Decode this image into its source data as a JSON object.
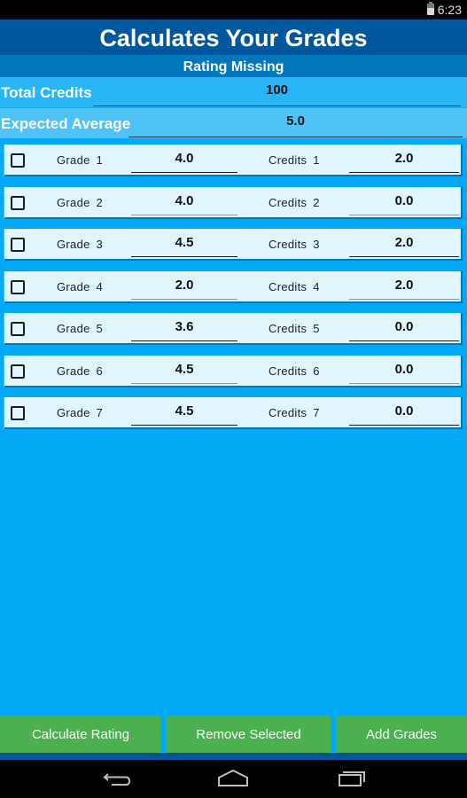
{
  "status_bar": {
    "time": "6:23",
    "battery_icon": "battery-icon"
  },
  "header": {
    "title": "Calculates Your Grades",
    "rating_status": "Rating Missing"
  },
  "summary": {
    "total_credits": {
      "label": "Total Credits",
      "value": "100"
    },
    "expected_average": {
      "label": "Expected Average",
      "value": "5.0"
    }
  },
  "grades": [
    {
      "grade_label": "Grade  1",
      "grade_value": "4.0",
      "credits_label": "Credits  1",
      "credits_value": "2.0",
      "checked": false
    },
    {
      "grade_label": "Grade  2",
      "grade_value": "4.0",
      "credits_label": "Credits  2",
      "credits_value": "0.0",
      "checked": false
    },
    {
      "grade_label": "Grade  3",
      "grade_value": "4.5",
      "credits_label": "Credits  3",
      "credits_value": "2.0",
      "checked": false
    },
    {
      "grade_label": "Grade  4",
      "grade_value": "2.0",
      "credits_label": "Credits  4",
      "credits_value": "2.0",
      "checked": false
    },
    {
      "grade_label": "Grade  5",
      "grade_value": "3.6",
      "credits_label": "Credits  5",
      "credits_value": "0.0",
      "checked": false
    },
    {
      "grade_label": "Grade  6",
      "grade_value": "4.5",
      "credits_label": "Credits  6",
      "credits_value": "0.0",
      "checked": false
    },
    {
      "grade_label": "Grade  7",
      "grade_value": "4.5",
      "credits_label": "Credits  7",
      "credits_value": "0.0",
      "checked": false
    }
  ],
  "buttons": {
    "calculate": "Calculate Rating",
    "remove": "Remove Selected",
    "add": "Add Grades"
  },
  "nav": {
    "back": "back-icon",
    "home": "home-icon",
    "recents": "recents-icon"
  },
  "colors": {
    "title_bar": "#01579b",
    "rating_bar": "#0277bd",
    "background": "#03a9f4",
    "row_card": "#e1f5fe",
    "button": "#4caf50"
  }
}
